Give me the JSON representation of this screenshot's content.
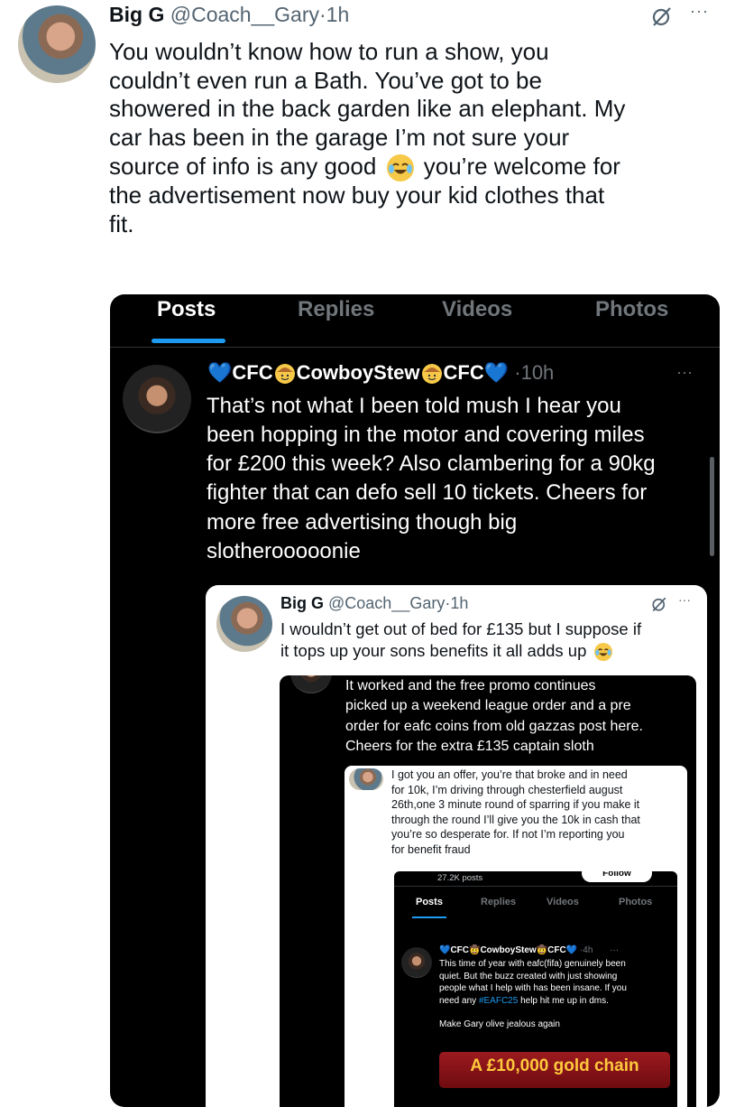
{
  "main_tweet": {
    "name": "Big G",
    "handle": "@Coach__Gary",
    "separator": "·",
    "time": "1h",
    "text_lines": [
      "You wouldn’t know how to run a show, you",
      "couldn’t even run a Bath. You’ve got to be",
      "showered in the back garden like an elephant. My",
      "car has been in the garage I’m not sure your",
      "source of info is any good",
      "you’re welcome for",
      "the advertisement now buy your kid clothes that",
      "fit."
    ],
    "emoji": "laughing-face-emoji",
    "more_glyph": "···"
  },
  "screenshot": {
    "tabs": [
      "Posts",
      "Replies",
      "Videos",
      "Photos"
    ],
    "reply": {
      "name_prefix": "💙CFC",
      "name_middle": "CowboyStew",
      "name_suffix": "CFC💙",
      "separator": "·",
      "time": "10h",
      "text_lines": [
        "That’s not what I been told mush I hear you",
        "been hopping in the motor and covering miles",
        "for £200 this week? Also clambering for a 90kg",
        "fighter that can defo sell 10 tickets. Cheers for",
        "more free advertising though big",
        "slotherooooonie"
      ],
      "more_glyph": "···"
    },
    "quote": {
      "name": "Big G",
      "handle": "@Coach__Gary",
      "separator": "·",
      "time": "1h",
      "text_lines": [
        "I wouldn’t get out of bed for £135 but I suppose if",
        "it tops up your sons benefits it all adds up"
      ],
      "more_glyph": "···",
      "inner": {
        "text_lines": [
          "It worked and the free promo continues",
          "picked up a weekend league order and a pre",
          "order for eafc coins from old gazzas post here.",
          "Cheers for the extra £135 captain sloth"
        ],
        "card": {
          "text_lines": [
            "I got you an offer, you’re that broke and in need",
            "for 10k, I’m driving through chesterfield august",
            "26th,one 3 minute round of sparring if you make it",
            "through the round I’ll give you the 10k in cash that",
            "you’re so desperate for. If not I’m reporting you",
            "for benefit fraud"
          ],
          "posts_count": "27.2K posts",
          "follow_label": "Follow",
          "tabs": [
            "Posts",
            "Replies",
            "Videos",
            "Photos"
          ],
          "mini_tweet": {
            "name": "💙CFC🤠CowboyStew🤠CFC💙",
            "separator": "·",
            "time": "4h",
            "more_glyph": "···",
            "text_lines": [
              "This time of year with eafc(fifa) genuinely been",
              "quiet. But the buzz created with just showing",
              "people what I help with has been insane. If you",
              "need any",
              "help hit me up in dms."
            ],
            "hashtag": "#EAFC25",
            "extra_line": "Make Gary olive jealous again",
            "banner_text": "A £10,000 gold chain"
          }
        }
      }
    }
  },
  "colors": {
    "accent_blue": "#1d9bf0",
    "dark_bg": "#000000",
    "muted": "#536471",
    "banner_red": "#8e1016",
    "banner_gold": "#ffc93c"
  }
}
